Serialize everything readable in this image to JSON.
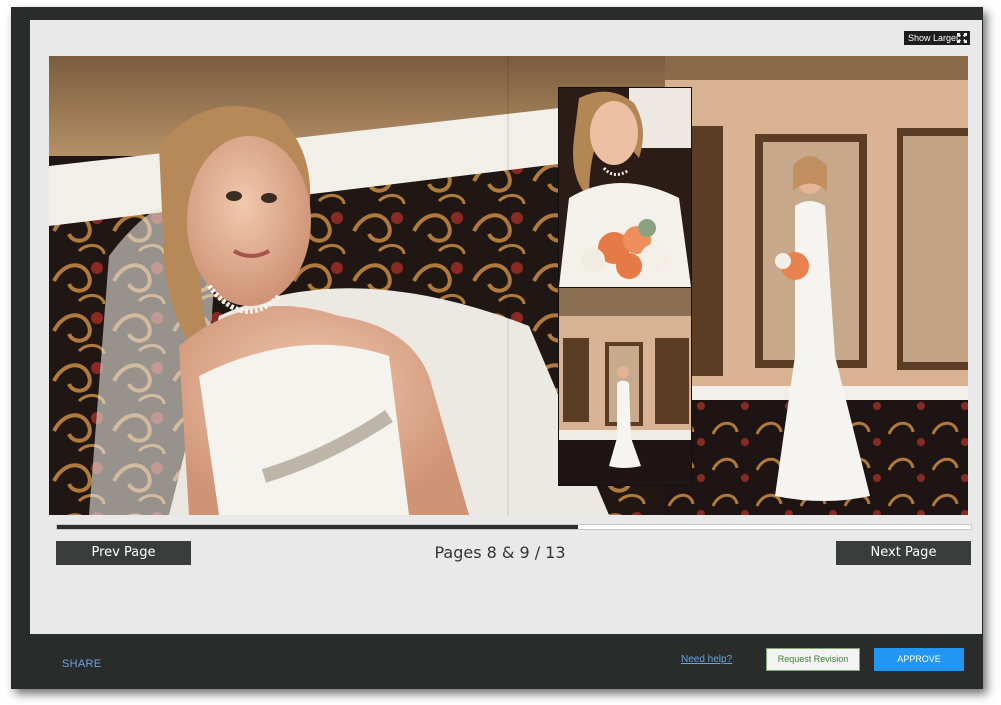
{
  "viewer": {
    "show_larger_label": "Show Larger",
    "expand_icon": "expand-arrows-icon"
  },
  "album": {
    "spread_photos": [
      "bride-portrait-photo",
      "bride-bouquet-closeup-photo",
      "bride-mirror-room-photo",
      "bride-full-length-photo"
    ],
    "progress_fraction": 0.57
  },
  "navigation": {
    "prev_label": "Prev Page",
    "next_label": "Next Page",
    "page_indicator": "Pages 8 & 9 / 13"
  },
  "footer": {
    "share_label": "SHARE",
    "help_label": "Need help?",
    "revision_label": "Request Revision",
    "approve_label": "APPROVE"
  },
  "colors": {
    "approve": "#2196f3",
    "link": "#6aa5de",
    "revision_text": "#3b7f33",
    "frame": "#2a2c2c"
  }
}
